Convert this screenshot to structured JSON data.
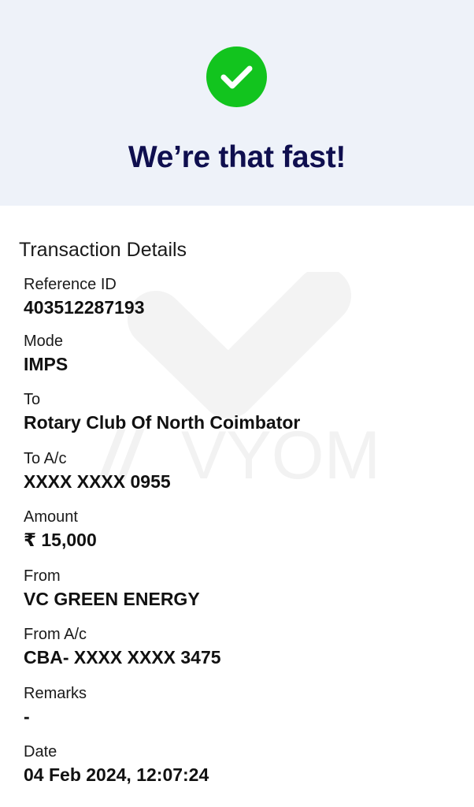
{
  "status": {
    "icon": "check-icon",
    "headline": "We’re that fast!",
    "colors": {
      "success": "#12c41e",
      "headline": "#0f0f4f",
      "header_bg": "#eef2f9"
    }
  },
  "watermark": {
    "icon": "vyom-logo-icon",
    "text": "VYOM"
  },
  "details": {
    "title": "Transaction Details",
    "reference_id": {
      "label": "Reference ID",
      "value": "403512287193"
    },
    "mode": {
      "label": "Mode",
      "value": "IMPS"
    },
    "to": {
      "label": "To",
      "value": "Rotary Club Of North Coimbator"
    },
    "to_account": {
      "label": "To A/c",
      "value": "XXXX XXXX 0955"
    },
    "amount": {
      "label": "Amount",
      "value": "₹ 15,000"
    },
    "from": {
      "label": "From",
      "value": "VC GREEN ENERGY"
    },
    "from_account": {
      "label": "From A/c",
      "value": "CBA- XXXX XXXX 3475"
    },
    "remarks": {
      "label": "Remarks",
      "value": "-"
    },
    "date": {
      "label": "Date",
      "value": "04 Feb 2024, 12:07:24"
    }
  }
}
